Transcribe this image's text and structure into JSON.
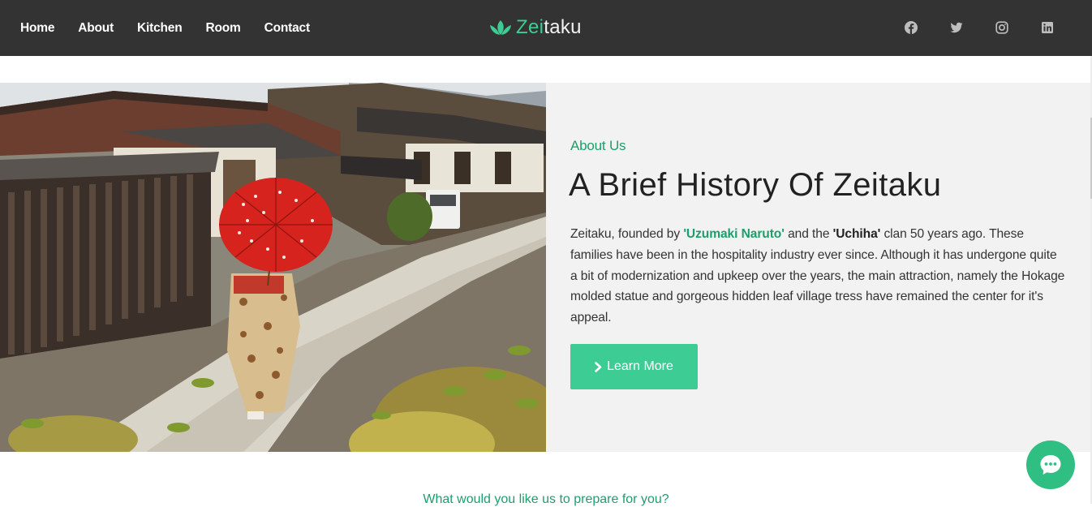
{
  "nav": {
    "links": [
      "Home",
      "About",
      "Kitchen",
      "Room",
      "Contact"
    ],
    "brand_part1": "Zei",
    "brand_part2": "taku",
    "socials": [
      "facebook-icon",
      "twitter-icon",
      "instagram-icon",
      "linkedin-icon"
    ]
  },
  "about": {
    "eyebrow": "About Us",
    "headline": "A Brief History Of Zeitaku",
    "body": {
      "t1": "Zeitaku, founded by ",
      "name1": "'Uzumaki Naruto'",
      "t2": " and the ",
      "name2": "'Uchiha'",
      "t3": " clan 50 years ago. These families have been in the hospitality industry ever since. Although it has undergone quite a bit of modernization and upkeep over the years, the main attraction, namely the Hokage molded statue and gorgeous hidden leaf village tress have remained the center for it's appeal."
    },
    "button_label": "Learn More",
    "image": "japanese-street-umbrella-photo"
  },
  "next_section": {
    "subtitle": "What would you like us to prepare for you?"
  },
  "chat_widget": "chat-bubble-icon",
  "colors": {
    "accent": "#3dcc94",
    "accent_dark": "#1e9e6c",
    "nav_bg": "#333333",
    "panel_bg": "#f2f2f2"
  }
}
